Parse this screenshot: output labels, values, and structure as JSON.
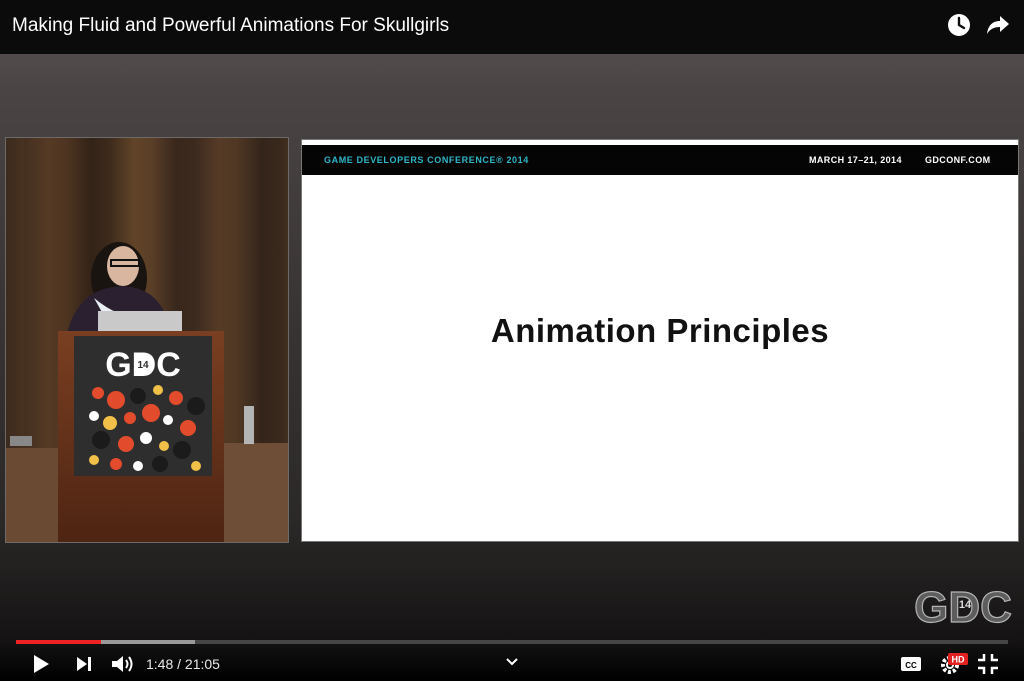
{
  "video": {
    "title": "Making Fluid and Powerful Animations For Skullgirls"
  },
  "top_icons": {
    "watch_later": "clock-icon",
    "share": "share-arrow-icon"
  },
  "slide": {
    "conference": "GAME DEVELOPERS CONFERENCE® 2014",
    "dates": "MARCH 17–21, 2014",
    "site": "GDCONF.COM",
    "title": "Animation Principles"
  },
  "podium": {
    "logo_text": "GDC",
    "logo_number": "14"
  },
  "watermark": {
    "text": "GDC",
    "number": "14"
  },
  "controls": {
    "current_time": "1:48",
    "separator": " / ",
    "duration": "21:05",
    "progress_fraction": 0.0854,
    "buffered_fraction": 0.18,
    "hd_badge": "HD",
    "icons": [
      "play-icon",
      "next-icon",
      "volume-icon",
      "chevron-down-icon",
      "captions-icon",
      "settings-icon",
      "exit-fullscreen-icon"
    ]
  },
  "colors": {
    "progress_played": "#e22222",
    "hd_badge": "#e22222",
    "slide_accent": "#2fb6c9"
  }
}
